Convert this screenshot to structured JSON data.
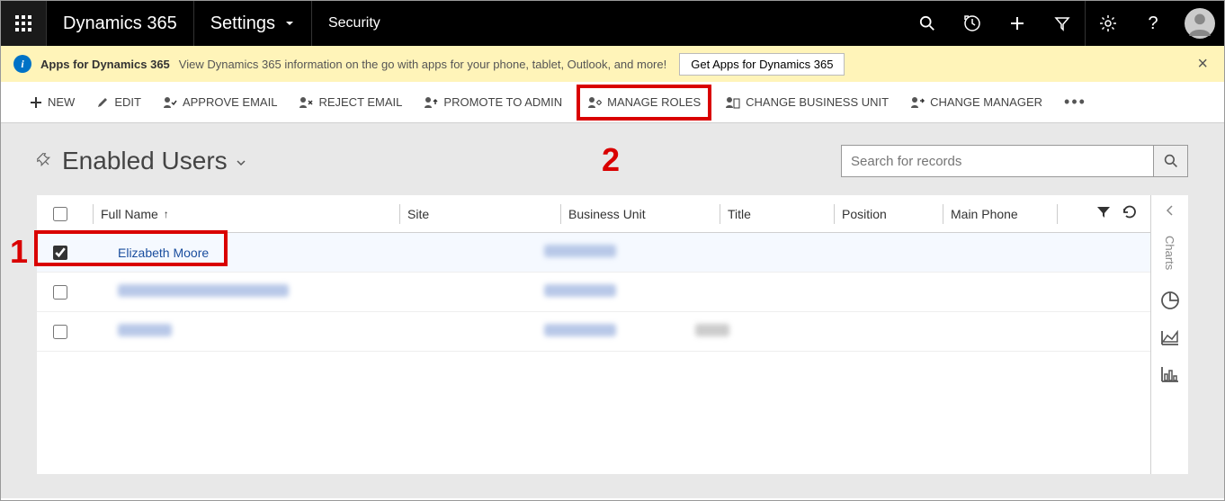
{
  "nav": {
    "brand": "Dynamics 365",
    "area": "Settings",
    "context": "Security"
  },
  "banner": {
    "title": "Apps for Dynamics 365",
    "text": "View Dynamics 365 information on the go with apps for your phone, tablet, Outlook, and more!",
    "button": "Get Apps for Dynamics 365"
  },
  "commands": {
    "new": "NEW",
    "edit": "EDIT",
    "approve_email": "APPROVE EMAIL",
    "reject_email": "REJECT EMAIL",
    "promote_admin": "PROMOTE TO ADMIN",
    "manage_roles": "MANAGE ROLES",
    "change_bu": "CHANGE BUSINESS UNIT",
    "change_manager": "CHANGE MANAGER"
  },
  "view": {
    "title": "Enabled Users",
    "search_placeholder": "Search for records"
  },
  "columns": {
    "fullname": "Full Name",
    "site": "Site",
    "bu": "Business Unit",
    "title": "Title",
    "position": "Position",
    "phone": "Main Phone"
  },
  "rows": [
    {
      "checked": true,
      "fullname": "Elizabeth Moore"
    },
    {
      "checked": false,
      "fullname": ""
    },
    {
      "checked": false,
      "fullname": ""
    }
  ],
  "charts_label": "Charts",
  "annotations": {
    "one": "1",
    "two": "2"
  }
}
